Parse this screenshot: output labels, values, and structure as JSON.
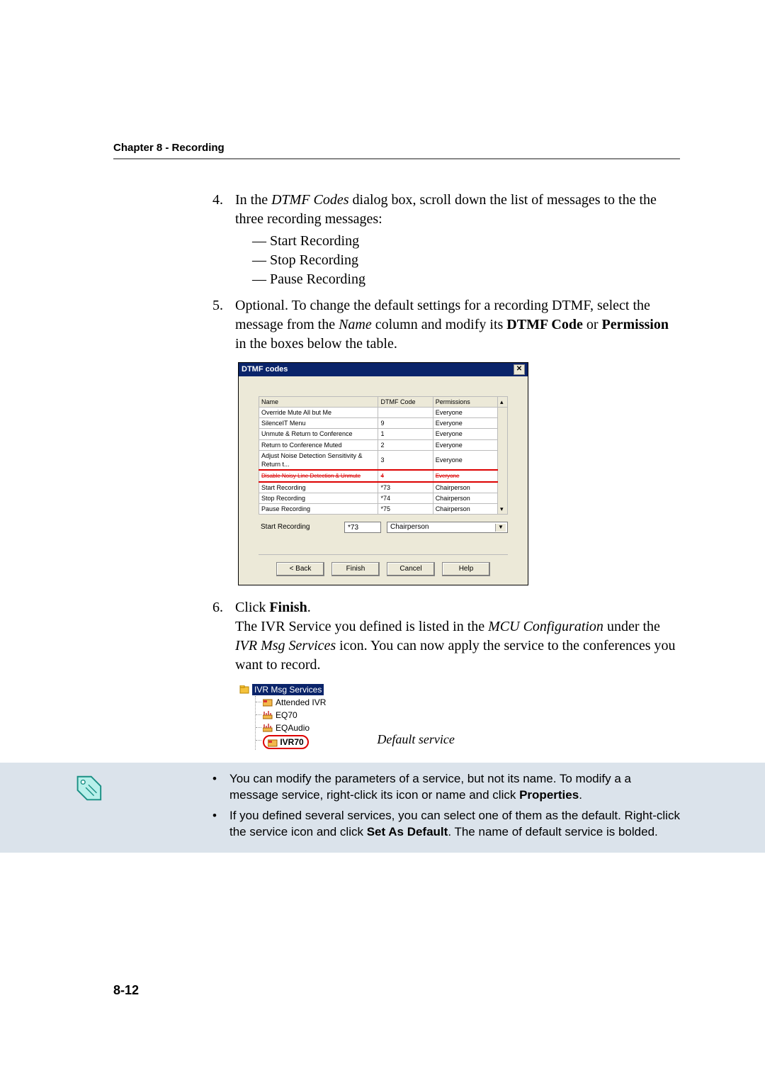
{
  "header": {
    "chapter_line": "Chapter 8 - Recording"
  },
  "steps": {
    "s4": {
      "num": "4.",
      "pre": "In the ",
      "em1": "DTMF Codes",
      "post": " dialog box, scroll down the list of messages to the the three recording messages:",
      "items": [
        "Start Recording",
        "Stop Recording",
        "Pause Recording"
      ]
    },
    "s5": {
      "num": "5.",
      "a": "Optional. To change the default settings for a recording DTMF, select the message from the ",
      "em1": "Name",
      "b": " column and modify its ",
      "st1": "DTMF Code",
      "c": " or ",
      "st2": "Permission",
      "d": " in the boxes below the table."
    },
    "s6": {
      "num": "6.",
      "a": "Click ",
      "st1": "Finish",
      "b": ".",
      "p2a": "The IVR Service you defined is listed in the ",
      "em1": "MCU Configuration",
      "p2b": " under the ",
      "em2": "IVR Msg Services",
      "p2c": " icon. You can now apply the service to the conferences you want to record."
    }
  },
  "dialog": {
    "title": "DTMF codes",
    "cols": {
      "name": "Name",
      "code": "DTMF Code",
      "perm": "Permissions"
    },
    "rows": [
      {
        "name": "Override Mute All but Me",
        "code": "",
        "perm": "Everyone"
      },
      {
        "name": "SilenceIT Menu",
        "code": "9",
        "perm": "Everyone"
      },
      {
        "name": "Unmute & Return to Conference",
        "code": "1",
        "perm": "Everyone"
      },
      {
        "name": "Return to Conference Muted",
        "code": "2",
        "perm": "Everyone"
      },
      {
        "name": "Adjust Noise Detection Sensitivity & Return t...",
        "code": "3",
        "perm": "Everyone"
      }
    ],
    "redrow": {
      "name": "Disable Noisy Line Detection & Unmute",
      "code": "4",
      "perm": "Everyone"
    },
    "rows2": [
      {
        "name": "Start Recording",
        "code": "*73",
        "perm": "Chairperson"
      },
      {
        "name": "Stop Recording",
        "code": "*74",
        "perm": "Chairperson"
      },
      {
        "name": "Pause Recording",
        "code": "*75",
        "perm": "Chairperson"
      }
    ],
    "edit": {
      "name": "Start Recording",
      "code": "*73",
      "perm": "Chairperson"
    },
    "buttons": {
      "back": "< Back",
      "finish": "Finish",
      "cancel": "Cancel",
      "help": "Help"
    }
  },
  "tree": {
    "root": "IVR Msg Services",
    "n1": "Attended IVR",
    "n2": "EQ70",
    "n3": "EQAudio",
    "n4": "IVR70",
    "caption": "Default service"
  },
  "note": {
    "b1a": "You can modify the parameters of a service, but not its name. To modify a a message service, right-click its icon or name and click ",
    "b1s": "Properties",
    "b1b": ".",
    "b2a": "If you defined several services, you can select one of them as the default. Right-click the service icon and click ",
    "b2s": "Set As Default",
    "b2b": ". The name of default service is bolded."
  },
  "footer": {
    "page": "8-12"
  }
}
